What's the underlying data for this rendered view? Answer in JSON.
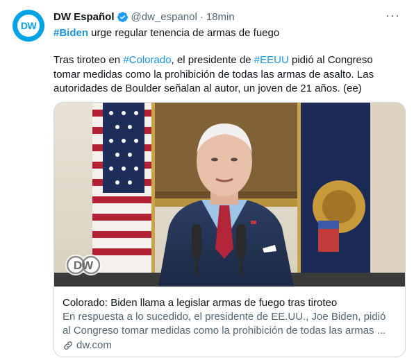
{
  "account": {
    "display_name": "DW Español",
    "handle": "@dw_espanol",
    "separator": "·",
    "time": "18min",
    "avatar_text": "DW"
  },
  "more_menu": "···",
  "headline": {
    "hashtag": "#Biden",
    "rest": " urge regular tenencia de armas de fuego"
  },
  "body": {
    "p1": "Tras tiroteo en ",
    "hashtag_colorado": "#Colorado",
    "p2": ", el presidente de ",
    "hashtag_eeuu": "#EEUU",
    "p3": " pidió al Congreso tomar medidas como la prohibición de todas las armas de asalto. Las autoridades de Boulder señalan al autor, un joven de 21 años. (ee)"
  },
  "card": {
    "logo_text": "DW",
    "title": "Colorado: Biden llama a legislar armas de fuego tras tiroteo",
    "description": "En respuesta a lo sucedido, el presidente de EE.UU., Joe Biden, pidió al Congreso tomar medidas como la prohibición de todas las armas ...",
    "domain": "dw.com"
  },
  "icons": {
    "verified": "verified-badge-icon",
    "more": "more-options-icon",
    "link": "link-icon"
  },
  "colors": {
    "link_blue": "#1b95e0",
    "dw_blue": "#05a2e5",
    "text_secondary": "#536471"
  }
}
